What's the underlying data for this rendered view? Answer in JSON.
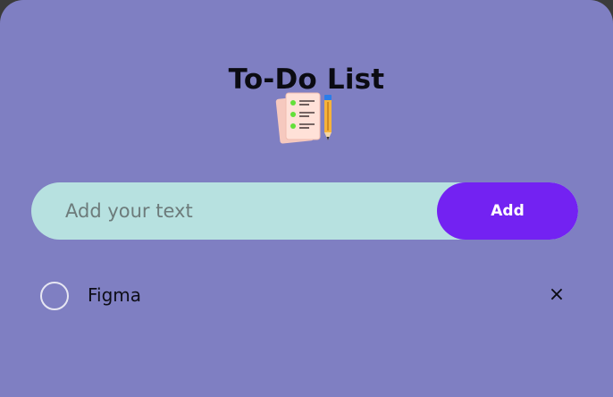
{
  "app": {
    "title": "To-Do List",
    "hero_icon": "checklist-with-pencil-icon"
  },
  "input": {
    "placeholder": "Add your text",
    "value": ""
  },
  "add_button": {
    "label": "Add"
  },
  "tasks": [
    {
      "text": "Figma",
      "checked": false,
      "delete_label": "×"
    }
  ],
  "colors": {
    "background": "#7f7fc2",
    "input_background": "#b7e1e0",
    "accent": "#7322f2"
  }
}
